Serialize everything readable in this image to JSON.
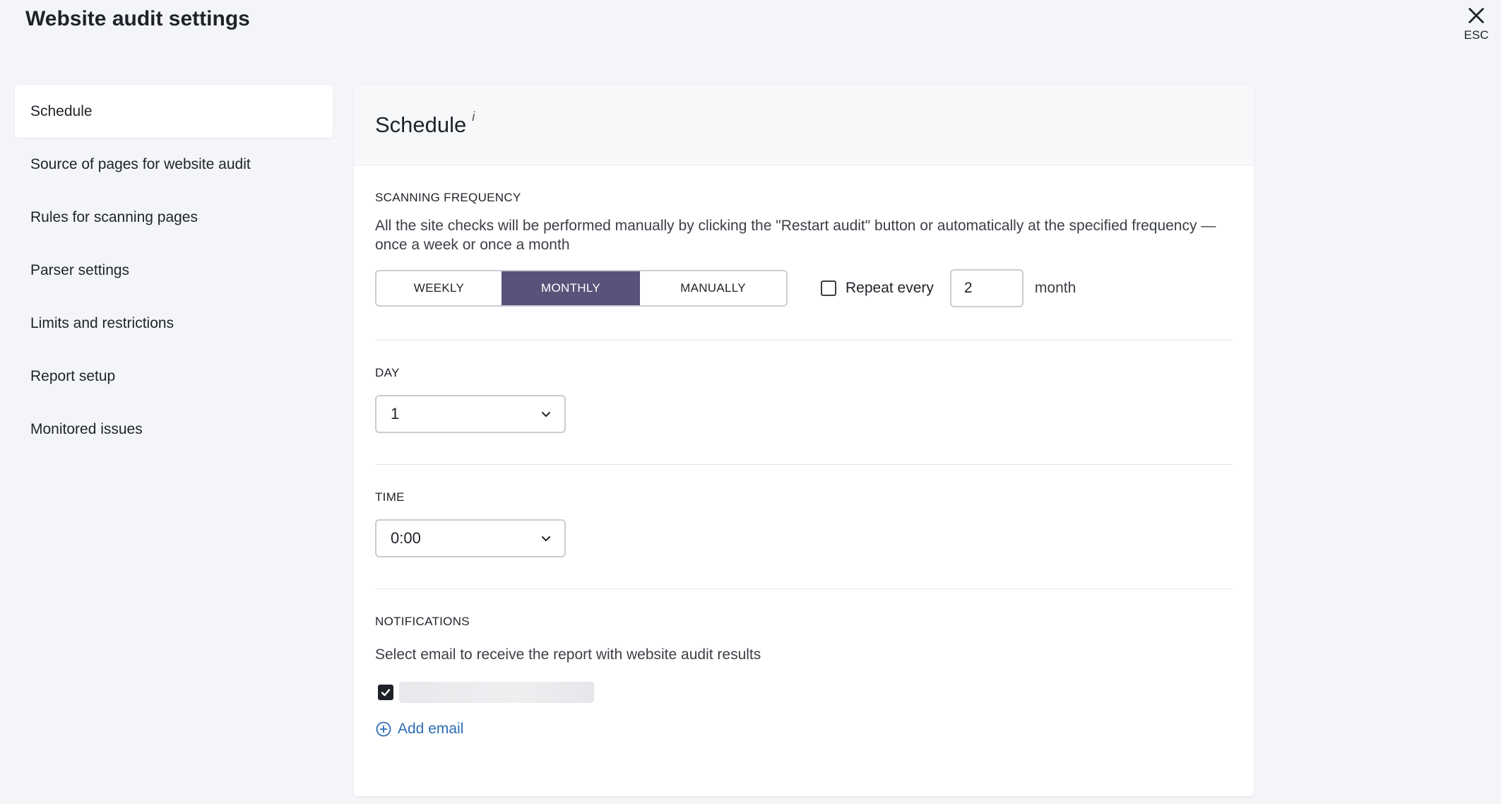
{
  "header": {
    "title": "Website audit settings",
    "close_hint": "ESC"
  },
  "sidebar": {
    "items": [
      {
        "label": "Schedule",
        "active": true
      },
      {
        "label": "Source of pages for website audit"
      },
      {
        "label": "Rules for scanning pages"
      },
      {
        "label": "Parser settings"
      },
      {
        "label": "Limits and restrictions"
      },
      {
        "label": "Report setup"
      },
      {
        "label": "Monitored issues"
      }
    ]
  },
  "main": {
    "title": "Schedule",
    "info_mark": "i",
    "frequency": {
      "label": "SCANNING FREQUENCY",
      "description": "All the site checks will be performed manually by clicking the \"Restart audit\" button or automatically at the specified frequency — once a week or once a month",
      "options": [
        "WEEKLY",
        "MONTHLY",
        "MANUALLY"
      ],
      "selected": "MONTHLY",
      "repeat_label": "Repeat every",
      "repeat_checked": false,
      "repeat_value": "2",
      "repeat_unit": "month"
    },
    "day": {
      "label": "DAY",
      "value": "1"
    },
    "time": {
      "label": "TIME",
      "value": "0:00"
    },
    "notifications": {
      "label": "NOTIFICATIONS",
      "description": "Select email to receive the report with website audit results",
      "email_checked": true,
      "add_email_label": "Add email"
    }
  },
  "colors": {
    "accent": "#5a527a",
    "link": "#2c6db5",
    "background": "#f4f5f8"
  }
}
